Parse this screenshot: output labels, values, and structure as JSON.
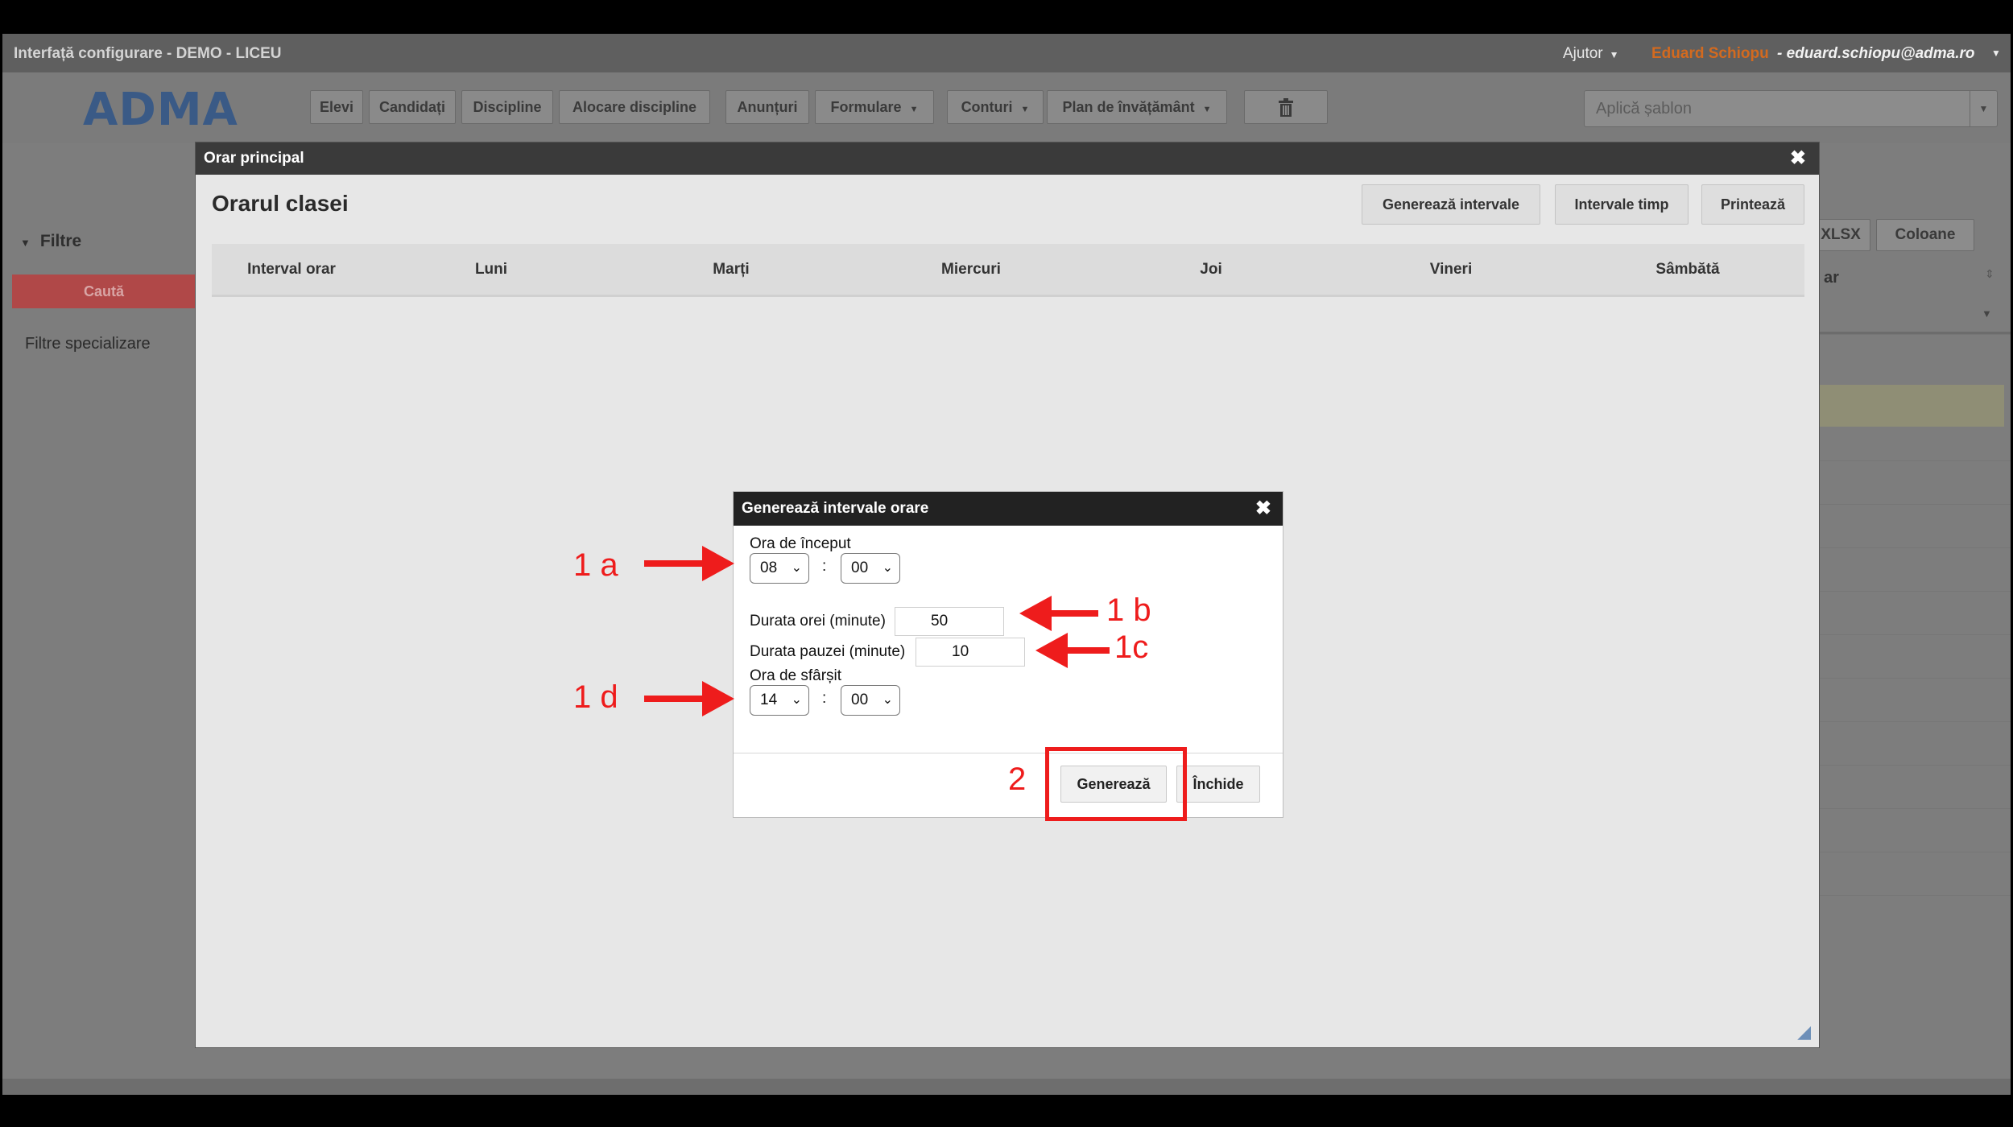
{
  "topbar": {
    "app_title": "Interfață configurare - DEMO - LICEU",
    "help": "Ajutor",
    "user_name": "Eduard Schiopu",
    "user_email": "- eduard.schiopu@adma.ro"
  },
  "logo": "ADMA",
  "nav": {
    "elevi": "Elevi",
    "candidati": "Candidați",
    "discipline": "Discipline",
    "alocare": "Alocare discipline",
    "anunturi": "Anunțuri",
    "formulare": "Formulare",
    "conturi": "Conturi",
    "plan": "Plan de învățământ",
    "template_placeholder": "Aplică șablon"
  },
  "sidebar": {
    "filters": "Filtre",
    "search": "Caută",
    "spec_filters": "Filtre specializare"
  },
  "background": {
    "xlsx": "XLSX",
    "columns": "Coloane",
    "col_fragment": "ar"
  },
  "modal": {
    "title": "Orar principal",
    "heading": "Orarul clasei",
    "buttons": {
      "generate": "Generează intervale",
      "intervals": "Intervale timp",
      "print": "Printează"
    },
    "columns": [
      "Interval orar",
      "Luni",
      "Marți",
      "Miercuri",
      "Joi",
      "Vineri",
      "Sâmbătă"
    ]
  },
  "dialog": {
    "title": "Generează intervale orare",
    "start_label": "Ora de început",
    "start_hour": "08",
    "start_min": "00",
    "lesson_label": "Durata orei (minute)",
    "lesson_value": "50",
    "break_label": "Durata pauzei (minute)",
    "break_value": "10",
    "end_label": "Ora de sfârșit",
    "end_hour": "14",
    "end_min": "00",
    "colon": ":",
    "generate_btn": "Generează",
    "close_btn": "Închide"
  },
  "annotations": {
    "a1": "1 a",
    "b1": "1 b",
    "c1": "1c",
    "d1": "1 d",
    "n2": "2"
  },
  "colors": {
    "annotation": "#ee1c1c",
    "user_name": "#d36a1f",
    "search_btn": "#b04848"
  }
}
